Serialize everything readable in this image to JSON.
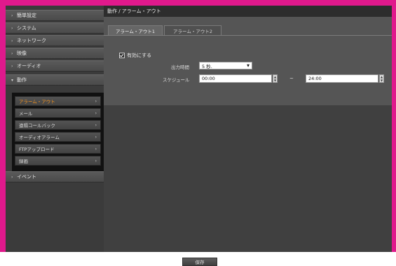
{
  "sidebar": {
    "items": [
      {
        "label": "簡単設定"
      },
      {
        "label": "システム"
      },
      {
        "label": "ネットワーク"
      },
      {
        "label": "映像"
      },
      {
        "label": "オーディオ"
      },
      {
        "label": "動作"
      },
      {
        "label": "イベント"
      }
    ],
    "submenu": [
      {
        "label": "アラーム・アウト"
      },
      {
        "label": "メール"
      },
      {
        "label": "遠隔コールバック"
      },
      {
        "label": "オーディオアラーム"
      },
      {
        "label": "FTPアップロード"
      },
      {
        "label": "録画"
      }
    ]
  },
  "header": {
    "title": "動作 / アラーム・アウト"
  },
  "tabs": [
    {
      "label": "アラーム・アウト1"
    },
    {
      "label": "アラーム・アウト2"
    }
  ],
  "form": {
    "enable_label": "有効にする",
    "duration_label": "出力時間",
    "duration_value": "5 秒.",
    "schedule_label": "スケジュール",
    "start_time": "00:00",
    "end_time": "24:00",
    "separator": "~"
  },
  "footer": {
    "save_label": "保存"
  }
}
